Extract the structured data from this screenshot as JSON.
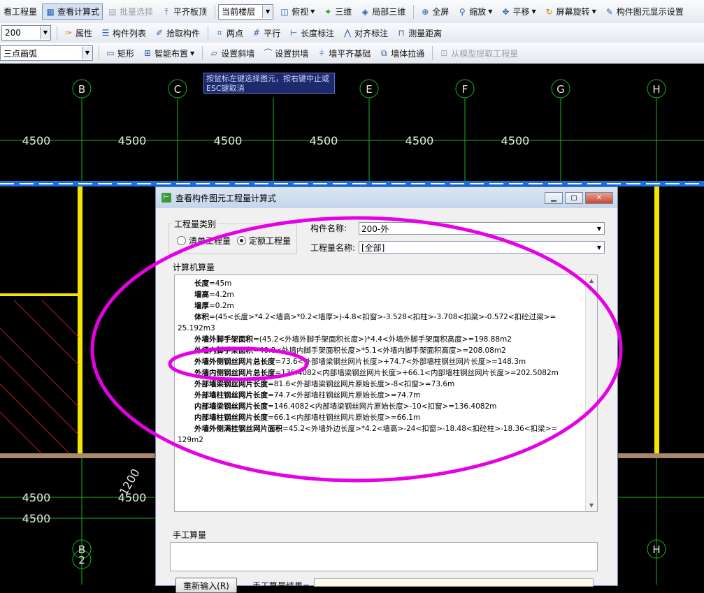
{
  "toolbar1": {
    "items": [
      {
        "label": "看工程量",
        "icon": "table-icon"
      },
      {
        "label": "查看计算式",
        "icon": "calc-icon"
      },
      {
        "label": "批量选择",
        "icon": "batch-select-icon"
      },
      {
        "label": "平齐板顶",
        "icon": "align-slab-icon"
      }
    ],
    "floor_combo": "当前楼层",
    "view_items": [
      {
        "label": "俯视",
        "icon": "top-view-icon"
      },
      {
        "label": "三维",
        "icon": "3d-icon"
      },
      {
        "label": "局部三维",
        "icon": "local-3d-icon"
      },
      {
        "label": "全屏",
        "icon": "fullscreen-icon"
      },
      {
        "label": "缩放",
        "icon": "zoom-icon"
      },
      {
        "label": "平移",
        "icon": "pan-icon"
      },
      {
        "label": "屏幕旋转",
        "icon": "rotate-icon"
      },
      {
        "label": "构件图元显示设置",
        "icon": "display-settings-icon"
      }
    ]
  },
  "toolbar2": {
    "size_combo": "200",
    "items": [
      {
        "label": "属性",
        "icon": "properties-icon"
      },
      {
        "label": "构件列表",
        "icon": "list-icon"
      },
      {
        "label": "拾取构件",
        "icon": "pick-icon"
      },
      {
        "label": "两点",
        "icon": "two-point-icon"
      },
      {
        "label": "平行",
        "icon": "parallel-icon"
      },
      {
        "label": "长度标注",
        "icon": "length-dim-icon"
      },
      {
        "label": "对齐标注",
        "icon": "align-dim-icon"
      },
      {
        "label": "测量距离",
        "icon": "measure-icon"
      }
    ]
  },
  "toolbar3": {
    "arc_label": "三点画弧",
    "items": [
      {
        "label": "矩形",
        "icon": "rect-icon"
      },
      {
        "label": "智能布置",
        "icon": "smart-layout-icon"
      },
      {
        "label": "设置斜墙",
        "icon": "slant-wall-icon"
      },
      {
        "label": "设置拱墙",
        "icon": "arch-wall-icon"
      },
      {
        "label": "墙平齐基础",
        "icon": "wall-align-base-icon"
      },
      {
        "label": "墙体拉通",
        "icon": "wall-connect-icon"
      },
      {
        "label": "从模型提取工程量",
        "icon": "extract-icon"
      }
    ]
  },
  "canvas": {
    "axis_labels": [
      "B",
      "C",
      "E",
      "F",
      "G",
      "H"
    ],
    "bottom_axis_labels": [
      "B",
      "2",
      "H"
    ],
    "dimension_top": "4500",
    "dimension_bottom": "4500",
    "diag_dimension": "1200",
    "tip_text": "按鼠标左键选择图元，按右键中止或ESC键取消"
  },
  "dialog": {
    "title": "查看构件图元工程量计算式",
    "quantity_type_label": "工程量类别",
    "radio_list": "清单工程量",
    "radio_quota": "定额工程量",
    "component_name_label": "构件名称:",
    "component_name_value": "200-外",
    "quantity_name_label": "工程量名称:",
    "quantity_name_value": "[全部]",
    "computer_calc_label": "计算机算量",
    "manual_calc_label": "手工算量",
    "reenter_button": "重新输入(R)",
    "manual_result_label": "手工算量结果=",
    "lines": [
      {
        "name": "长度",
        "expr": "=45m"
      },
      {
        "name": "墙高",
        "expr": "=4.2m"
      },
      {
        "name": "墙厚",
        "expr": "=0.2m"
      },
      {
        "name": "体积",
        "expr": "=(45<长度>*4.2<墙高>*0.2<墙厚>)-4.8<扣窗>-3.528<扣柱>-3.708<扣梁>-0.572<扣砼过梁>="
      },
      {
        "name": "",
        "expr": "25.192m3"
      },
      {
        "name": "外墙外脚手架面积",
        "expr": "=(45.2<外墙外脚手架面积长度>)*4.4<外墙外脚手架面积高度>=198.88m2"
      },
      {
        "name": "外墙内脚手架面积",
        "expr": "=40.8<外墙内脚手架面积长度>*5.1<外墙内脚手架面积高度>=208.08m2"
      },
      {
        "name": "外墙外侧钢丝网片总长度",
        "expr": "=73.6<外部墙梁钢丝网片长度>+74.7<外部墙柱钢丝网片长度>=148.3m"
      },
      {
        "name": "外墙内侧钢丝网片总长度",
        "expr": "=136.4082<内部墙梁钢丝网片长度>+66.1<内部墙柱钢丝网片长度>=202.5082m"
      },
      {
        "name": "外部墙梁钢丝网片长度",
        "expr": "=81.6<外部墙梁钢丝网片原始长度>-8<扣窗>=73.6m"
      },
      {
        "name": "外部墙柱钢丝网片长度",
        "expr": "=74.7<外部墙柱钢丝网片原始长度>=74.7m"
      },
      {
        "name": "内部墙梁钢丝网片长度",
        "expr": "=146.4082<内部墙梁钢丝网片原始长度>-10<扣窗>=136.4082m"
      },
      {
        "name": "内部墙柱钢丝网片长度",
        "expr": "=66.1<内部墙柱钢丝网片原始长度>=66.1m"
      },
      {
        "name": "外墙外侧满挂钢丝网片面积",
        "expr": "=45.2<外墙外边长度>*4.2<墙高>-24<扣窗>-18.48<扣砼柱>-18.36<扣梁>="
      },
      {
        "name": "",
        "expr": "129m2"
      }
    ]
  },
  "colors": {
    "annotation": "#e600e6",
    "grid_green": "#1bb31b",
    "wall_yellow": "#f2e600",
    "beam_blue": "#1a6fe0"
  }
}
